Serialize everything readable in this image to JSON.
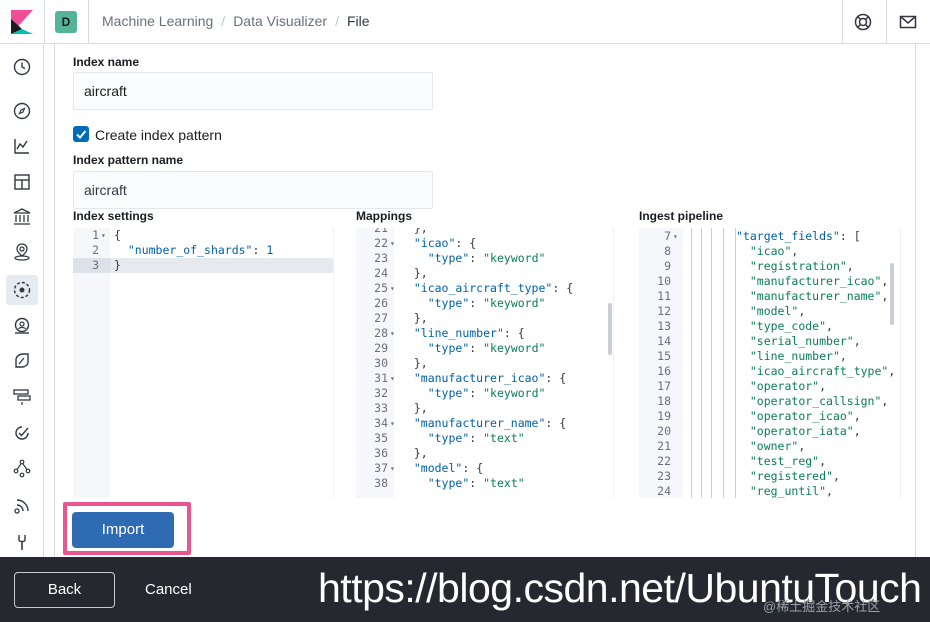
{
  "header": {
    "space_initial": "D",
    "breadcrumbs": [
      "Machine Learning",
      "Data Visualizer",
      "File"
    ],
    "separator": "/"
  },
  "nav": {
    "items": [
      "clock-icon",
      "compass-icon",
      "visualize-icon",
      "dashboard-icon",
      "canvas-icon",
      "maps-icon",
      "ml-icon",
      "metrics-icon",
      "logs-icon",
      "apm-icon",
      "uptime-icon",
      "graph-icon",
      "stack-monitoring-icon",
      "dev-tools-icon"
    ],
    "active": "ml-icon"
  },
  "form": {
    "index_name_label": "Index name",
    "index_name_value": "aircraft",
    "create_index_pattern_label": "Create index pattern",
    "create_index_pattern_checked": true,
    "index_pattern_name_label": "Index pattern name",
    "index_pattern_name_value": "aircraft",
    "index_settings_label": "Index settings",
    "mappings_label": "Mappings",
    "ingest_pipeline_label": "Ingest pipeline"
  },
  "index_settings": {
    "lines": [
      {
        "n": "1",
        "fold": true,
        "text": "{"
      },
      {
        "n": "2",
        "fold": false,
        "text": "  \"number_of_shards\": 1"
      },
      {
        "n": "3",
        "fold": false,
        "text": "}"
      }
    ]
  },
  "mappings": {
    "lines": [
      {
        "n": "21",
        "fold": false,
        "text": "  },"
      },
      {
        "n": "22",
        "fold": true,
        "text": "  \"icao\": {"
      },
      {
        "n": "23",
        "fold": false,
        "text": "    \"type\": \"keyword\""
      },
      {
        "n": "24",
        "fold": false,
        "text": "  },"
      },
      {
        "n": "25",
        "fold": true,
        "text": "  \"icao_aircraft_type\": {"
      },
      {
        "n": "26",
        "fold": false,
        "text": "    \"type\": \"keyword\""
      },
      {
        "n": "27",
        "fold": false,
        "text": "  },"
      },
      {
        "n": "28",
        "fold": true,
        "text": "  \"line_number\": {"
      },
      {
        "n": "29",
        "fold": false,
        "text": "    \"type\": \"keyword\""
      },
      {
        "n": "30",
        "fold": false,
        "text": "  },"
      },
      {
        "n": "31",
        "fold": true,
        "text": "  \"manufacturer_icao\": {"
      },
      {
        "n": "32",
        "fold": false,
        "text": "    \"type\": \"keyword\""
      },
      {
        "n": "33",
        "fold": false,
        "text": "  },"
      },
      {
        "n": "34",
        "fold": true,
        "text": "  \"manufacturer_name\": {"
      },
      {
        "n": "35",
        "fold": false,
        "text": "    \"type\": \"text\""
      },
      {
        "n": "36",
        "fold": false,
        "text": "  },"
      },
      {
        "n": "37",
        "fold": true,
        "text": "  \"model\": {"
      },
      {
        "n": "38",
        "fold": false,
        "text": "    \"type\": \"text\""
      }
    ]
  },
  "ingest_pipeline": {
    "lines": [
      {
        "n": "7",
        "fold": true,
        "text": "\"target_fields\": ["
      },
      {
        "n": "8",
        "fold": false,
        "text": "  \"icao\","
      },
      {
        "n": "9",
        "fold": false,
        "text": "  \"registration\","
      },
      {
        "n": "10",
        "fold": false,
        "text": "  \"manufacturer_icao\","
      },
      {
        "n": "11",
        "fold": false,
        "text": "  \"manufacturer_name\","
      },
      {
        "n": "12",
        "fold": false,
        "text": "  \"model\","
      },
      {
        "n": "13",
        "fold": false,
        "text": "  \"type_code\","
      },
      {
        "n": "14",
        "fold": false,
        "text": "  \"serial_number\","
      },
      {
        "n": "15",
        "fold": false,
        "text": "  \"line_number\","
      },
      {
        "n": "16",
        "fold": false,
        "text": "  \"icao_aircraft_type\","
      },
      {
        "n": "17",
        "fold": false,
        "text": "  \"operator\","
      },
      {
        "n": "18",
        "fold": false,
        "text": "  \"operator_callsign\","
      },
      {
        "n": "19",
        "fold": false,
        "text": "  \"operator_icao\","
      },
      {
        "n": "20",
        "fold": false,
        "text": "  \"operator_iata\","
      },
      {
        "n": "21",
        "fold": false,
        "text": "  \"owner\","
      },
      {
        "n": "22",
        "fold": false,
        "text": "  \"test_reg\","
      },
      {
        "n": "23",
        "fold": false,
        "text": "  \"registered\","
      },
      {
        "n": "24",
        "fold": false,
        "text": "  \"reg_until\","
      }
    ]
  },
  "actions": {
    "import_label": "Import",
    "back_label": "Back",
    "cancel_label": "Cancel"
  },
  "watermark": {
    "url": "https://blog.csdn.net/UbuntuTouch",
    "small": "@稀土掘金技术社区"
  },
  "colors": {
    "accent": "#006bb8",
    "import_button": "#2f6bb3",
    "highlight_box": "#e8568d",
    "bottom_bar": "#25282f"
  }
}
